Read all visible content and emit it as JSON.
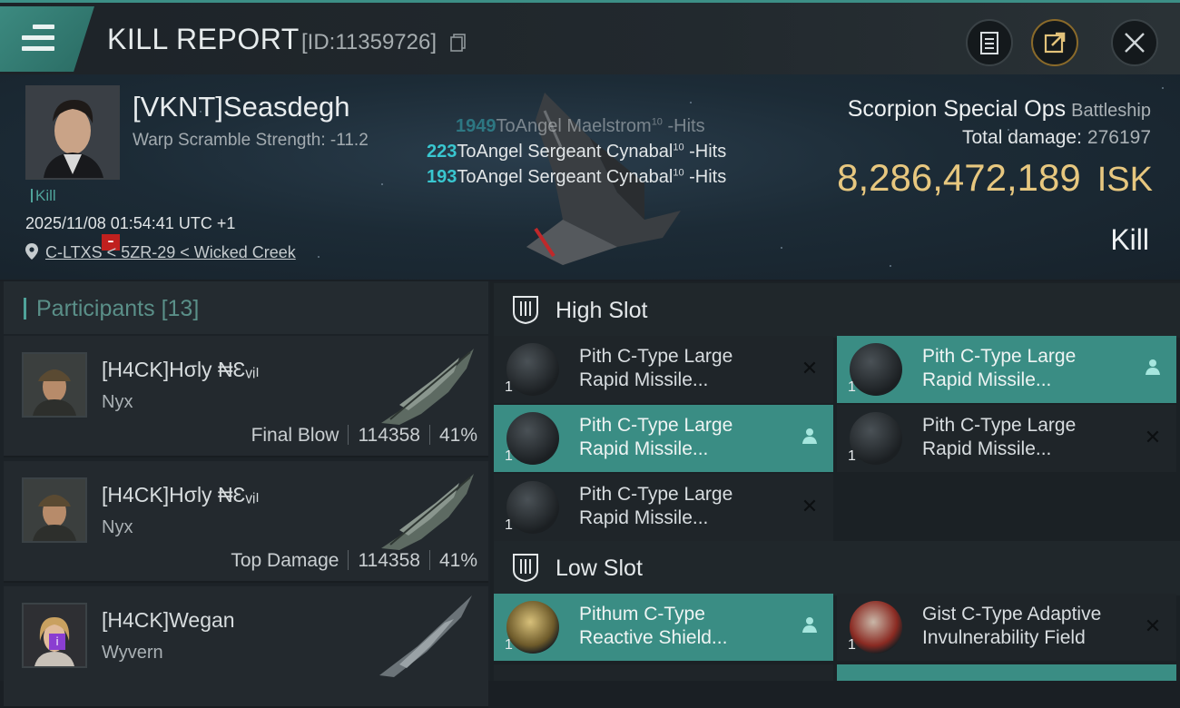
{
  "header": {
    "title": "KILL REPORT",
    "report_id": "[ID:11359726]"
  },
  "victim": {
    "name": "[VKNT]Seasdegh",
    "warp_scramble": "Warp Scramble Strength: -11.2",
    "kill_tag": "Kill",
    "timestamp": "2025/11/08 01:54:41 UTC +1",
    "location": "C-LTXS < 5ZR-29 < Wicked Creek",
    "ship_name": "Scorpion Special Ops",
    "ship_class": "Battleship",
    "total_damage_label": "Total damage:",
    "total_damage": "276197",
    "isk_value": "8,286,472,189",
    "isk_unit": "ISK",
    "result": "Kill",
    "hits": [
      {
        "count": "1949",
        "text": "ToAngel Maelstrom",
        "level": "10",
        "suffix": " -Hits"
      },
      {
        "count": "223",
        "text": "ToAngel Sergeant Cynabal",
        "level": "10",
        "suffix": " -Hits"
      },
      {
        "count": "193",
        "text": "ToAngel Sergeant Cynabal",
        "level": "10",
        "suffix": " -Hits"
      }
    ]
  },
  "participants": {
    "label": "Participants",
    "count": "[13]",
    "items": [
      {
        "name": "[H4CK]Hσly ₦Ɛᵥᵢₗ",
        "ship": "Nyx",
        "role": "Final Blow",
        "damage": "114358",
        "percent": "41%"
      },
      {
        "name": "[H4CK]Hσly ₦Ɛᵥᵢₗ",
        "ship": "Nyx",
        "role": "Top Damage",
        "damage": "114358",
        "percent": "41%"
      },
      {
        "name": "[H4CK]Wegan",
        "ship": "Wyvern",
        "role": "",
        "damage": "",
        "percent": ""
      }
    ]
  },
  "fitting": {
    "high_slot_label": "High Slot",
    "low_slot_label": "Low Slot",
    "high_slots": [
      {
        "line1": "Pith C-Type Large",
        "line2": "Rapid Missile...",
        "qty": "1",
        "state": "destroyed"
      },
      {
        "line1": "Pith C-Type Large",
        "line2": "Rapid Missile...",
        "qty": "1",
        "state": "dropped"
      },
      {
        "line1": "Pith C-Type Large",
        "line2": "Rapid Missile...",
        "qty": "1",
        "state": "dropped"
      },
      {
        "line1": "Pith C-Type Large",
        "line2": "Rapid Missile...",
        "qty": "1",
        "state": "destroyed"
      },
      {
        "line1": "Pith C-Type Large",
        "line2": "Rapid Missile...",
        "qty": "1",
        "state": "destroyed"
      }
    ],
    "low_slots": [
      {
        "line1": "Pithum C-Type",
        "line2": "Reactive Shield...",
        "qty": "1",
        "state": "dropped"
      },
      {
        "line1": "Gist C-Type Adaptive",
        "line2": "Invulnerability Field",
        "qty": "1",
        "state": "destroyed"
      }
    ],
    "icons": {
      "destroyed": "close-icon",
      "dropped": "person-icon"
    }
  },
  "colors": {
    "accent_teal": "#3a8d84",
    "isk_gold": "#e7c77f",
    "hit_cyan": "#39c7d0"
  }
}
